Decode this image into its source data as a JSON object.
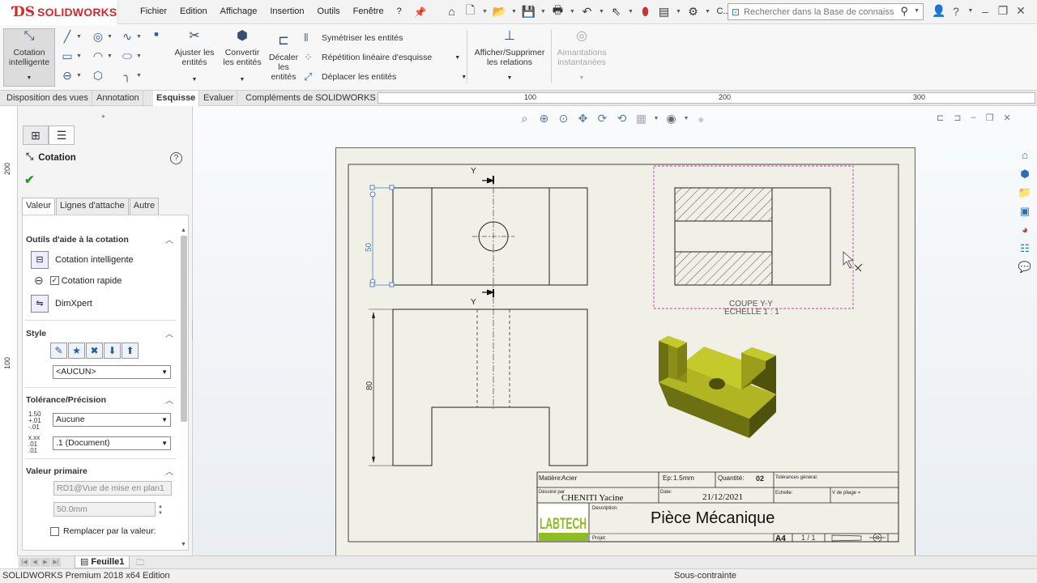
{
  "app": {
    "logo": "SOLIDWORKS",
    "menus": [
      "Fichier",
      "Edition",
      "Affichage",
      "Insertion",
      "Outils",
      "Fenêtre",
      "?"
    ],
    "qat_extra": "C...",
    "search_placeholder": "Rechercher dans la Base de connaissa"
  },
  "commands": {
    "smart_dimension": "Cotation intelligente",
    "trim": "Ajuster les entités",
    "convert": "Convertir les entités",
    "offset": "Décaler les entités",
    "mirror": "Symétriser les entités",
    "linear_pattern": "Répétition linéaire d'esquisse",
    "move": "Déplacer les entités",
    "relations": "Afficher/Supprimer les relations",
    "snaps": "Aimantations instantanées"
  },
  "tabs": [
    "Disposition des vues",
    "Annotation",
    "Esquisse",
    "Evaluer",
    "Compléments de SOLIDWORKS"
  ],
  "active_tab": "Esquisse",
  "ruler": {
    "h_ticks": [
      "100",
      "200",
      "300"
    ],
    "v_ticks": [
      "200",
      "100"
    ]
  },
  "property_manager": {
    "title": "Cotation",
    "help": "?",
    "subtabs": [
      "Valeur",
      "Lignes d'attache",
      "Autre"
    ],
    "sections": {
      "tools": {
        "header": "Outils d'aide à la cotation",
        "items": [
          "Cotation intelligente",
          "Cotation rapide",
          "DimXpert"
        ],
        "quick_checked": true
      },
      "style": {
        "header": "Style",
        "combo": "<AUCUN>"
      },
      "tolerance": {
        "header": "Tolérance/Précision",
        "tol_combo": "Aucune",
        "prec_combo": ".1 (Document)",
        "tol_icon": "1.50 +.01 -.01",
        "prec_icon": "x.xx .01 .01"
      },
      "primary": {
        "header": "Valeur primaire",
        "ref": "RD1@Vue de mise en plan1",
        "value": "50.0mm",
        "override": "Remplacer par la valeur:"
      }
    }
  },
  "sheet_tab": "Feuille1",
  "status": {
    "left": "SOLIDWORKS Premium 2018 x64 Edition",
    "right": "Sous-contrainte"
  },
  "drawing": {
    "section_label": "Y",
    "dim_height": "50",
    "dim_height2": "80",
    "section_title": "COUPE Y-Y",
    "section_scale": "ECHELLE 1 : 1",
    "title_block": {
      "material_label": "Matière:",
      "material": "Acier",
      "thickness_label": "Ep:",
      "thickness": "1.5mm",
      "quantity_label": "Quantité:",
      "quantity": "02",
      "tolerances_label": "Tolérances général:",
      "drawn_by_label": "Déssiné par",
      "drawn_by": "CHENITI Yacine",
      "date_label": "Date:",
      "date": "21/12/2021",
      "scale_label": "Echelle:",
      "check_label": "V de pliage =",
      "desc_label": "Description:",
      "title": "Pièce Mécanique",
      "project_label": "Projet:",
      "format": "A4",
      "sheet": "1 / 1",
      "company": "LABTECH"
    },
    "colors": {
      "part": "#a3a81a",
      "selection": "#c83fb0",
      "dimension": "#4a7fc2"
    }
  }
}
